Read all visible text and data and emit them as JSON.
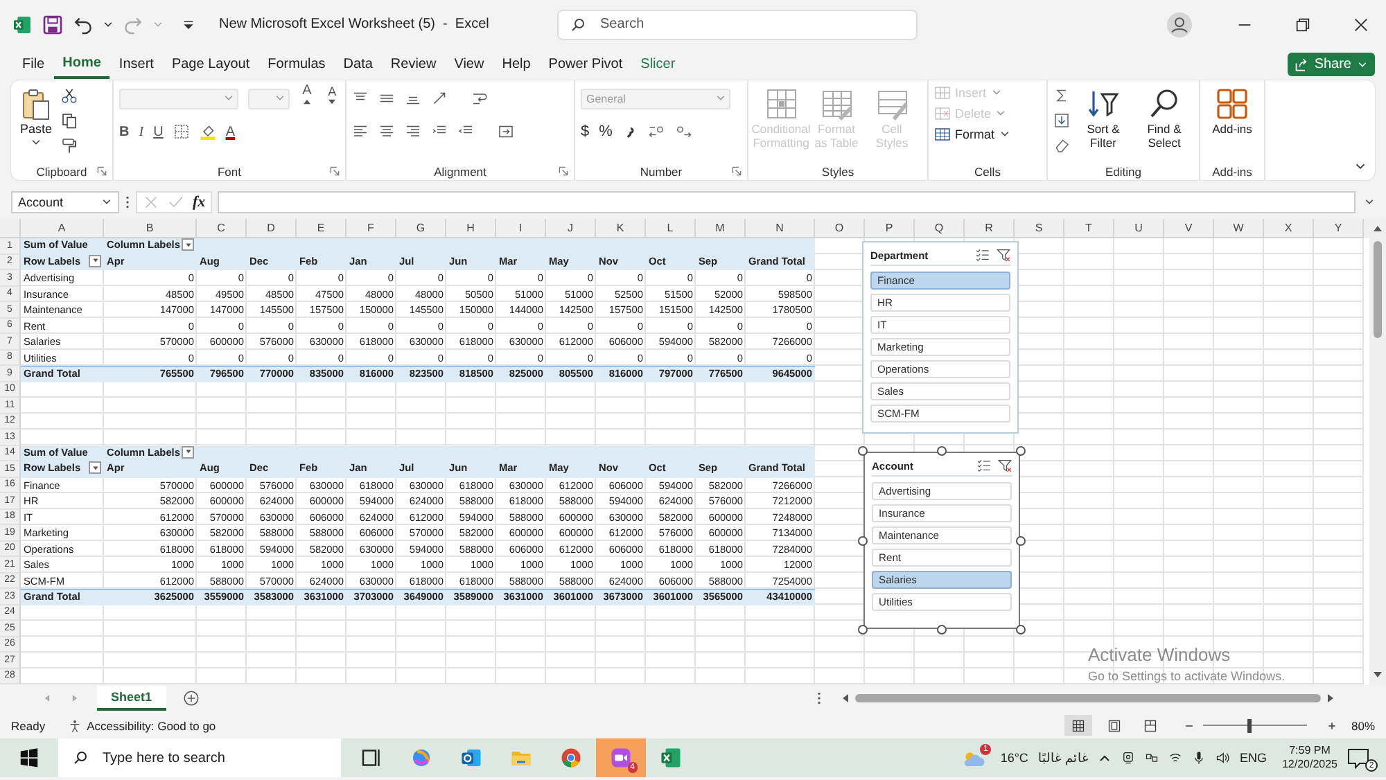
{
  "window": {
    "title": "New Microsoft Excel Worksheet (5)  -  Excel",
    "search_placeholder": "Search"
  },
  "menu": {
    "tabs": [
      {
        "label": "File",
        "selected": false,
        "kind": "standard"
      },
      {
        "label": "Home",
        "selected": true,
        "kind": "standard"
      },
      {
        "label": "Insert",
        "selected": false,
        "kind": "standard"
      },
      {
        "label": "Page Layout",
        "selected": false,
        "kind": "standard"
      },
      {
        "label": "Formulas",
        "selected": false,
        "kind": "standard"
      },
      {
        "label": "Data",
        "selected": false,
        "kind": "standard"
      },
      {
        "label": "Review",
        "selected": false,
        "kind": "standard"
      },
      {
        "label": "View",
        "selected": false,
        "kind": "standard"
      },
      {
        "label": "Help",
        "selected": false,
        "kind": "standard"
      },
      {
        "label": "Power Pivot",
        "selected": false,
        "kind": "standard"
      },
      {
        "label": "Slicer",
        "selected": false,
        "kind": "contextual"
      }
    ],
    "share": "Share"
  },
  "ribbon": {
    "groups": [
      {
        "kind": "clipboard",
        "label": "Clipboard",
        "paste": "Paste"
      },
      {
        "kind": "font",
        "label": "Font",
        "styles": [
          "B",
          "I",
          "U"
        ],
        "grow": "A",
        "shrink": "A",
        "font_color": "A"
      },
      {
        "kind": "alignment",
        "label": "Alignment"
      },
      {
        "kind": "number",
        "label": "Number",
        "format": "General",
        "currency": "$",
        "percent": "%"
      },
      {
        "kind": "large",
        "label": "Styles",
        "items": [
          {
            "label": "Conditional Formatting",
            "disabled": true
          },
          {
            "label": "Format as Table",
            "disabled": true
          },
          {
            "label": "Cell Styles",
            "disabled": true
          }
        ]
      },
      {
        "kind": "small",
        "label": "Cells",
        "items": [
          {
            "label": "Insert",
            "disabled": true
          },
          {
            "label": "Delete",
            "disabled": true
          },
          {
            "label": "Format",
            "disabled": false
          }
        ]
      },
      {
        "kind": "editing",
        "label": "Editing",
        "items": [
          {
            "label": "Sort & Filter",
            "disabled": false
          },
          {
            "label": "Find & Select",
            "disabled": false
          }
        ]
      },
      {
        "kind": "large",
        "label": "Add-ins",
        "items": [
          {
            "label": "Add-ins",
            "disabled": false
          }
        ]
      }
    ]
  },
  "formula_bar": {
    "name_box": "Account",
    "fx": "fx"
  },
  "sheet": {
    "columns": [
      "A",
      "B",
      "C",
      "D",
      "E",
      "F",
      "G",
      "H",
      "I",
      "J",
      "K",
      "L",
      "M",
      "N",
      "O",
      "P",
      "Q",
      "R",
      "S",
      "T",
      "U",
      "V",
      "W",
      "X",
      "Y"
    ],
    "rows": [
      {
        "number": "1",
        "kind": "header",
        "cells": [
          "Sum of Value",
          "Column Labels"
        ]
      },
      {
        "number": "2",
        "kind": "labels",
        "cells": [
          "Row Labels",
          "Apr",
          "Aug",
          "Dec",
          "Feb",
          "Jan",
          "Jul",
          "Jun",
          "Mar",
          "May",
          "Nov",
          "Oct",
          "Sep",
          "Grand Total"
        ]
      },
      {
        "number": "3",
        "kind": "item",
        "cells": [
          "Advertising",
          "0",
          "0",
          "0",
          "0",
          "0",
          "0",
          "0",
          "0",
          "0",
          "0",
          "0",
          "0",
          "0"
        ]
      },
      {
        "number": "4",
        "kind": "item",
        "cells": [
          "Insurance",
          "48500",
          "49500",
          "48500",
          "47500",
          "48000",
          "48000",
          "50500",
          "51000",
          "51000",
          "52500",
          "51500",
          "52000",
          "598500"
        ]
      },
      {
        "number": "5",
        "kind": "item",
        "cells": [
          "Maintenance",
          "147000",
          "147000",
          "145500",
          "157500",
          "150000",
          "145500",
          "150000",
          "144000",
          "142500",
          "157500",
          "151500",
          "142500",
          "1780500"
        ]
      },
      {
        "number": "6",
        "kind": "item",
        "cells": [
          "Rent",
          "0",
          "0",
          "0",
          "0",
          "0",
          "0",
          "0",
          "0",
          "0",
          "0",
          "0",
          "0",
          "0"
        ]
      },
      {
        "number": "7",
        "kind": "item",
        "cells": [
          "Salaries",
          "570000",
          "600000",
          "576000",
          "630000",
          "618000",
          "630000",
          "618000",
          "630000",
          "612000",
          "606000",
          "594000",
          "582000",
          "7266000"
        ]
      },
      {
        "number": "8",
        "kind": "item",
        "cells": [
          "Utilities",
          "0",
          "0",
          "0",
          "0",
          "0",
          "0",
          "0",
          "0",
          "0",
          "0",
          "0",
          "0",
          "0"
        ]
      },
      {
        "number": "9",
        "kind": "total",
        "cells": [
          "Grand Total",
          "765500",
          "796500",
          "770000",
          "835000",
          "816000",
          "823500",
          "818500",
          "825000",
          "805500",
          "816000",
          "797000",
          "776500",
          "9645000"
        ]
      },
      {
        "number": "10",
        "kind": "empty"
      },
      {
        "number": "11",
        "kind": "empty"
      },
      {
        "number": "12",
        "kind": "empty"
      },
      {
        "number": "13",
        "kind": "empty"
      },
      {
        "number": "14",
        "kind": "header",
        "cells": [
          "Sum of Value",
          "Column Labels"
        ]
      },
      {
        "number": "15",
        "kind": "labels",
        "cells": [
          "Row Labels",
          "Apr",
          "Aug",
          "Dec",
          "Feb",
          "Jan",
          "Jul",
          "Jun",
          "Mar",
          "May",
          "Nov",
          "Oct",
          "Sep",
          "Grand Total"
        ]
      },
      {
        "number": "16",
        "kind": "item",
        "cells": [
          "Finance",
          "570000",
          "600000",
          "576000",
          "630000",
          "618000",
          "630000",
          "618000",
          "630000",
          "612000",
          "606000",
          "594000",
          "582000",
          "7266000"
        ]
      },
      {
        "number": "17",
        "kind": "item",
        "cells": [
          "HR",
          "582000",
          "600000",
          "624000",
          "600000",
          "594000",
          "624000",
          "588000",
          "618000",
          "588000",
          "594000",
          "624000",
          "576000",
          "7212000"
        ]
      },
      {
        "number": "18",
        "kind": "item",
        "cells": [
          "IT",
          "612000",
          "570000",
          "630000",
          "606000",
          "624000",
          "612000",
          "594000",
          "588000",
          "600000",
          "630000",
          "582000",
          "600000",
          "7248000"
        ]
      },
      {
        "number": "19",
        "kind": "item",
        "cells": [
          "Marketing",
          "630000",
          "582000",
          "588000",
          "588000",
          "606000",
          "570000",
          "582000",
          "600000",
          "600000",
          "612000",
          "576000",
          "600000",
          "7134000"
        ]
      },
      {
        "number": "20",
        "kind": "item",
        "cells": [
          "Operations",
          "618000",
          "618000",
          "594000",
          "582000",
          "630000",
          "594000",
          "588000",
          "606000",
          "612000",
          "606000",
          "618000",
          "618000",
          "7284000"
        ]
      },
      {
        "number": "21",
        "kind": "item",
        "cells": [
          "Sales",
          "1000",
          "1000",
          "1000",
          "1000",
          "1000",
          "1000",
          "1000",
          "1000",
          "1000",
          "1000",
          "1000",
          "1000",
          "12000"
        ]
      },
      {
        "number": "22",
        "kind": "item",
        "cells": [
          "SCM-FM",
          "612000",
          "588000",
          "570000",
          "624000",
          "630000",
          "618000",
          "618000",
          "588000",
          "588000",
          "624000",
          "606000",
          "588000",
          "7254000"
        ]
      },
      {
        "number": "23",
        "kind": "total",
        "cells": [
          "Grand Total",
          "3625000",
          "3559000",
          "3583000",
          "3631000",
          "3703000",
          "3649000",
          "3589000",
          "3631000",
          "3601000",
          "3673000",
          "3601000",
          "3565000",
          "43410000"
        ]
      },
      {
        "number": "24",
        "kind": "empty"
      },
      {
        "number": "25",
        "kind": "empty"
      },
      {
        "number": "26",
        "kind": "empty"
      },
      {
        "number": "27",
        "kind": "empty"
      },
      {
        "number": "28",
        "kind": "empty"
      }
    ]
  },
  "slicers": [
    {
      "title": "Department",
      "selected": false,
      "items": [
        {
          "label": "Finance",
          "selected": true
        },
        {
          "label": "HR",
          "selected": false
        },
        {
          "label": "IT",
          "selected": false
        },
        {
          "label": "Marketing",
          "selected": false
        },
        {
          "label": "Operations",
          "selected": false
        },
        {
          "label": "Sales",
          "selected": false
        },
        {
          "label": "SCM-FM",
          "selected": false
        }
      ]
    },
    {
      "title": "Account",
      "selected": true,
      "items": [
        {
          "label": "Advertising",
          "selected": false
        },
        {
          "label": "Insurance",
          "selected": false
        },
        {
          "label": "Maintenance",
          "selected": false
        },
        {
          "label": "Rent",
          "selected": false
        },
        {
          "label": "Salaries",
          "selected": true
        },
        {
          "label": "Utilities",
          "selected": false
        }
      ]
    }
  ],
  "activation_notice": {
    "title": "Activate Windows",
    "text": "Go to Settings to activate Windows."
  },
  "sheet_tabs": [
    {
      "label": "Sheet1",
      "selected": true
    }
  ],
  "status_bar": {
    "mode": "Ready",
    "accessibility": "Accessibility: Good to go",
    "views": [
      {
        "selected": true
      },
      {
        "selected": false
      },
      {
        "selected": false
      }
    ],
    "zoom": {
      "level": 0.45,
      "reading": "80%"
    }
  },
  "taskbar": {
    "search_placeholder": "Type here to search",
    "apps": [
      {
        "active": false
      },
      {
        "active": false
      },
      {
        "active": false
      },
      {
        "active": false
      },
      {
        "active": false
      },
      {
        "active": true,
        "badge": "4"
      },
      {
        "active": false
      }
    ],
    "weather": {
      "badge": "1",
      "temperature": "16°C",
      "condition": "غائم غالبًا"
    },
    "language": "ENG",
    "time": "7:59 PM",
    "date": "12/20/2025",
    "notifications": "2"
  }
}
